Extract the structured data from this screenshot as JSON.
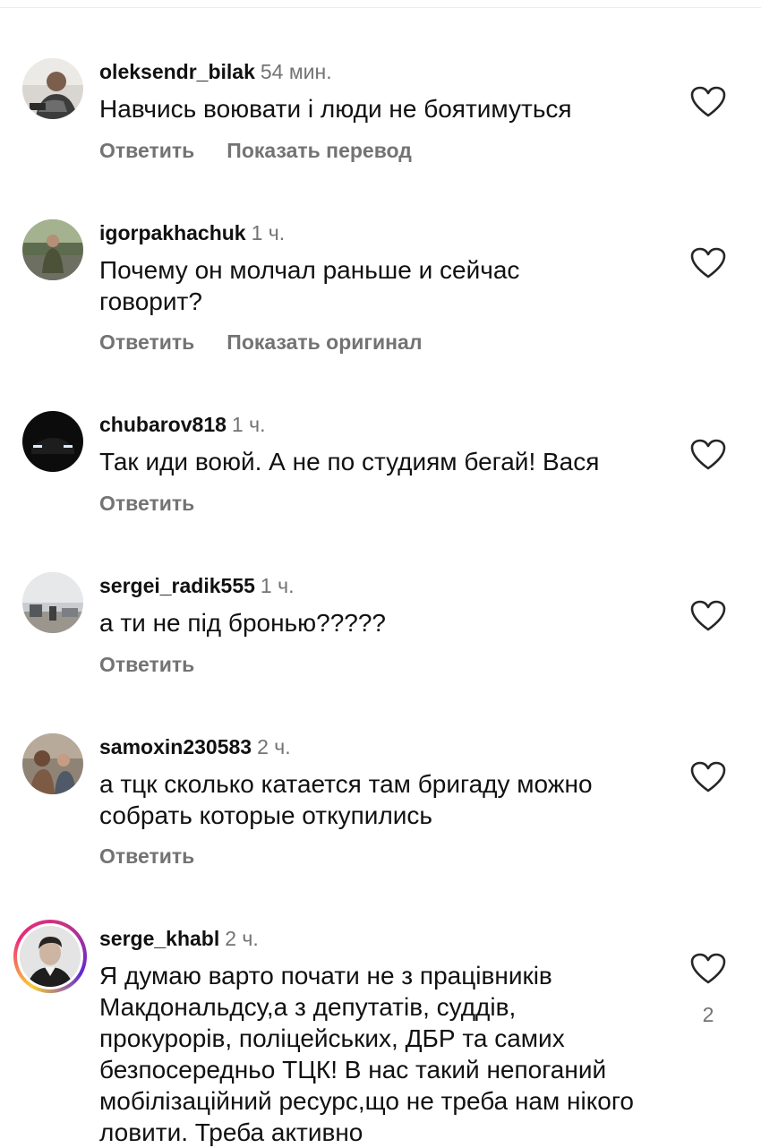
{
  "colors": {
    "text": "#111111",
    "muted": "#737373",
    "story_ring": [
      "#f9ce34",
      "#ee2a7b",
      "#6228d7"
    ]
  },
  "comments": [
    {
      "username": "oleksendr_bilak",
      "time": "54 мин.",
      "text": "Навчись воювати і люди не боятимуться",
      "actions": [
        "Ответить",
        "Показать перевод"
      ],
      "like_icon": "heart-outline-icon"
    },
    {
      "username": "igorpakhachuk",
      "time": "1 ч.",
      "text": "Почему он молчал раньше и сейчас говорит?",
      "actions": [
        "Ответить",
        "Показать оригинал"
      ],
      "like_icon": "heart-outline-icon"
    },
    {
      "username": "chubarov818",
      "time": "1 ч.",
      "text": "Так иди воюй. А не по студиям бегай! Вася",
      "actions": [
        "Ответить"
      ],
      "like_icon": "heart-outline-icon"
    },
    {
      "username": "sergei_radik555",
      "time": "1 ч.",
      "text": "а ти не під бронью?????",
      "actions": [
        "Ответить"
      ],
      "like_icon": "heart-outline-icon"
    },
    {
      "username": "samoxin230583",
      "time": "2 ч.",
      "text": "а тцк сколько катается там бригаду можно собрать которые откупились",
      "actions": [
        "Ответить"
      ],
      "like_icon": "heart-outline-icon"
    },
    {
      "username": "serge_khabl",
      "time": "2 ч.",
      "text": "Я думаю варто почати не з працівників Макдональдсу,а з депутатів, суддів, прокурорів, поліцейських, ДБР та самих безпосередньо ТЦК! В нас такий непоганий мобілізаційний ресурс,що не треба нам нікого ловити. Треба активно",
      "like_count": "2",
      "like_icon": "heart-outline-icon"
    }
  ]
}
